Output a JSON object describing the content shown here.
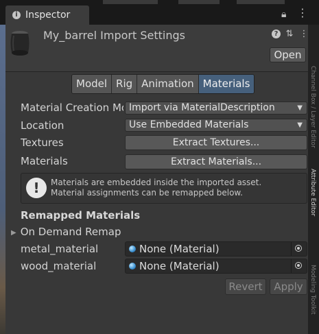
{
  "window": {
    "tab_label": "Inspector",
    "top_icons": [
      "lock-icon",
      "kebab-menu-icon"
    ]
  },
  "header": {
    "title": "My_barrel Import Settings",
    "icons": [
      "help-icon",
      "preset-icon",
      "kebab-menu-icon"
    ],
    "open_label": "Open"
  },
  "tabs": [
    {
      "label": "Model",
      "active": false
    },
    {
      "label": "Rig",
      "active": false
    },
    {
      "label": "Animation",
      "active": false
    },
    {
      "label": "Materials",
      "active": true
    }
  ],
  "fields": {
    "material_creation": {
      "label": "Material Creation Mo",
      "value": "Import via MaterialDescription"
    },
    "location": {
      "label": "Location",
      "value": "Use Embedded Materials"
    },
    "textures": {
      "label": "Textures",
      "button": "Extract Textures..."
    },
    "materials": {
      "label": "Materials",
      "button": "Extract Materials..."
    }
  },
  "helpbox": {
    "line1": "Materials are embedded inside the imported asset.",
    "line2": "Material assignments can be remapped below."
  },
  "remapped": {
    "section_title": "Remapped Materials",
    "foldout_label": "On Demand Remap",
    "items": [
      {
        "name": "metal_material",
        "value": "None (Material)"
      },
      {
        "name": "wood_material",
        "value": "None (Material)"
      }
    ]
  },
  "footer": {
    "revert_label": "Revert",
    "apply_label": "Apply"
  },
  "side_tabs": [
    "Channel Box / Layer Editor",
    "Attribute Editor",
    "Modeling Toolkit"
  ],
  "colors": {
    "active_tab": "#46607c",
    "panel_bg": "#3c3c3c"
  }
}
